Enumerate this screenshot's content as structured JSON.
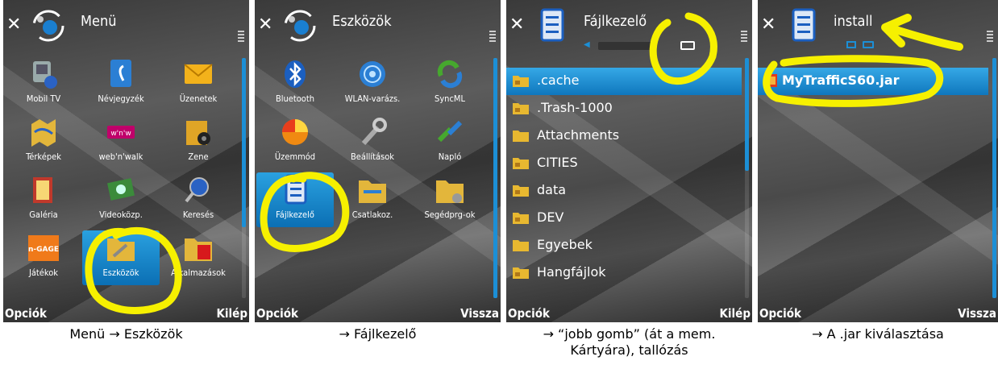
{
  "panels": [
    {
      "title": "Menü",
      "left_softkey": "Opciók",
      "right_softkey": "Kilép",
      "caption": "Menü → Eszközök",
      "apps": [
        "Mobil TV",
        "Névjegyzék",
        "Üzenetek",
        "Térképek",
        "web'n'walk",
        "Zene",
        "Galéria",
        "Videoközp.",
        "Keresés",
        "Játékok",
        "Eszközök",
        "Alkalmazások"
      ]
    },
    {
      "title": "Eszközök",
      "left_softkey": "Opciók",
      "right_softkey": "Vissza",
      "caption": "→ Fájlkezelő",
      "apps": [
        "Bluetooth",
        "WLAN-varázs.",
        "SyncML",
        "Üzemmód",
        "Beállítások",
        "Napló",
        "Fájlkezelő",
        "Csatlakoz.",
        "Segédprg-ok"
      ]
    },
    {
      "title": "Fájlkezelő",
      "left_softkey": "Opciók",
      "right_softkey": "Kilép",
      "caption_line1": "→ “jobb gomb” (át a mem.",
      "caption_line2": "Kártyára), tallózás",
      "folders": [
        ".cache",
        ".Trash-1000",
        "Attachments",
        "CITIES",
        "data",
        "DEV",
        "Egyebek",
        "Hangfájlok"
      ]
    },
    {
      "title": "install",
      "left_softkey": "Opciók",
      "right_softkey": "Vissza",
      "caption": "→ A .jar kiválasztása",
      "file": "MyTrafficS60.jar"
    }
  ],
  "colors": {
    "highlight": "#f6f000",
    "selection": "#1c8fd6",
    "background": "#4a4a4a"
  },
  "icons": [
    "close-icon",
    "menu-orb-icon",
    "file-manager-icon",
    "folder-icon",
    "memory-card-icon",
    "jar-file-icon"
  ]
}
